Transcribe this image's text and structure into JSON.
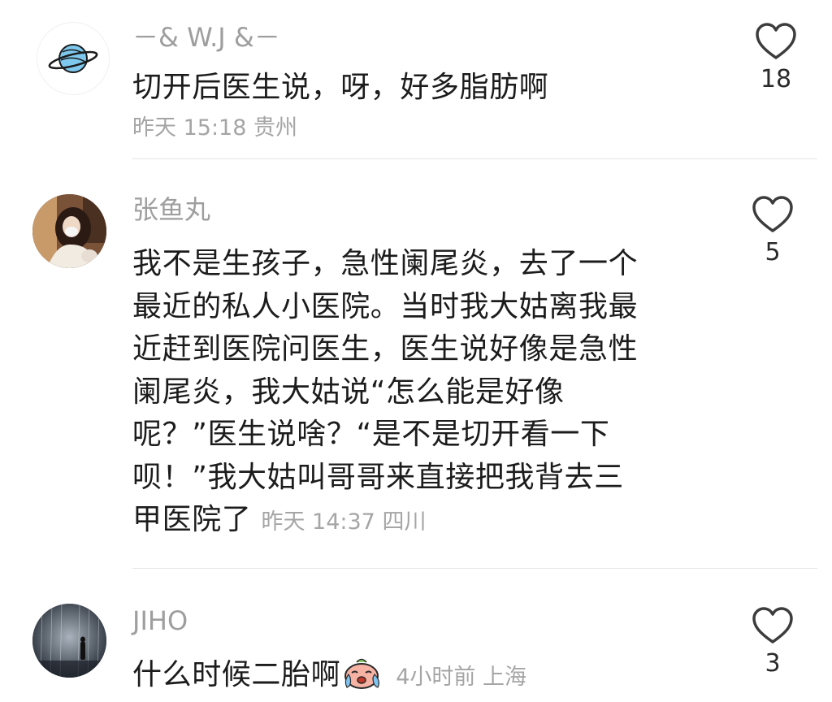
{
  "comments": [
    {
      "username": "－& W.J &－",
      "text": "切开后医生说，呀，好多脂肪啊",
      "time": "昨天 15:18",
      "location": "贵州",
      "likes": "18",
      "avatar_icon": "planet-icon"
    },
    {
      "username": "张鱼丸",
      "text_lines": [
        "我不是生孩子，急性阑尾炎，去了一个",
        "最近的私人小医院。当时我大姑离我最",
        "近赶到医院问医生，医生说好像是急性",
        "阑尾炎，我大姑说“怎么能是好像",
        "呢？”医生说啥？“是不是切开看一下",
        "呗！”我大姑叫哥哥来直接把我背去三",
        "甲医院了"
      ],
      "time": "昨天 14:37",
      "location": "四川",
      "likes": "5",
      "avatar_icon": "girl-photo-avatar"
    },
    {
      "username": "JIHO",
      "text": "什么时候二胎啊",
      "emoji": "crying-emoji",
      "time": "4小时前",
      "location": "上海",
      "likes": "3",
      "avatar_icon": "rain-figure-avatar"
    }
  ],
  "colors": {
    "username": "#9e9e9e",
    "text": "#1c1c1c",
    "meta": "#a5a5a5",
    "divider": "#e6e6e6"
  }
}
